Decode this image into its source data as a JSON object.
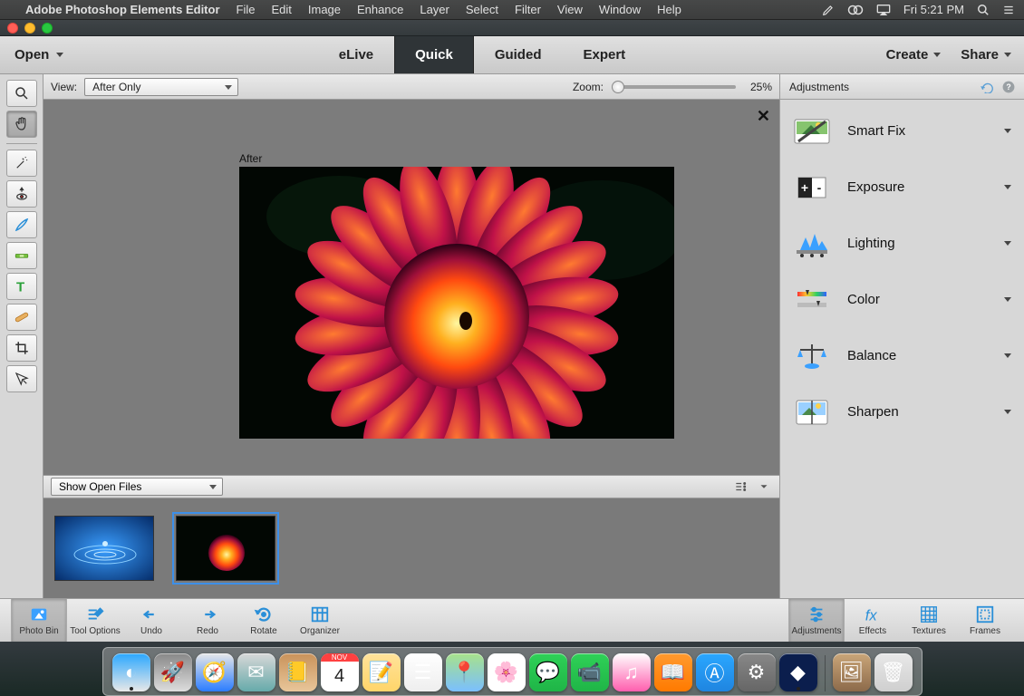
{
  "menubar": {
    "app_name": "Adobe Photoshop Elements Editor",
    "items": [
      "File",
      "Edit",
      "Image",
      "Enhance",
      "Layer",
      "Select",
      "Filter",
      "View",
      "Window",
      "Help"
    ],
    "clock": "Fri 5:21 PM"
  },
  "modebar": {
    "open_label": "Open",
    "tabs": [
      "eLive",
      "Quick",
      "Guided",
      "Expert"
    ],
    "active_tab": "Quick",
    "create_label": "Create",
    "share_label": "Share"
  },
  "viewbar": {
    "view_label": "View:",
    "view_value": "After Only",
    "zoom_label": "Zoom:",
    "zoom_value": "25%"
  },
  "canvas": {
    "after_label": "After"
  },
  "openfiles": {
    "dropdown": "Show Open Files"
  },
  "left_tools": [
    {
      "name": "zoom-tool",
      "icon": "zoom"
    },
    {
      "name": "hand-tool",
      "icon": "hand",
      "selected": true
    },
    {
      "name": "quick-select-tool",
      "icon": "wand"
    },
    {
      "name": "redeye-tool",
      "icon": "redeye"
    },
    {
      "name": "whiten-teeth-tool",
      "icon": "brush"
    },
    {
      "name": "straighten-tool",
      "icon": "level"
    },
    {
      "name": "type-tool",
      "icon": "type"
    },
    {
      "name": "spot-heal-tool",
      "icon": "bandaid"
    },
    {
      "name": "crop-tool",
      "icon": "crop"
    },
    {
      "name": "move-tool",
      "icon": "move"
    }
  ],
  "adjustments_panel": {
    "title": "Adjustments",
    "items": [
      {
        "label": "Smart Fix",
        "icon": "smartfix"
      },
      {
        "label": "Exposure",
        "icon": "exposure"
      },
      {
        "label": "Lighting",
        "icon": "lighting"
      },
      {
        "label": "Color",
        "icon": "color"
      },
      {
        "label": "Balance",
        "icon": "balance"
      },
      {
        "label": "Sharpen",
        "icon": "sharpen"
      }
    ]
  },
  "bottombar": {
    "left": [
      {
        "label": "Photo Bin",
        "icon": "photobin",
        "selected": true
      },
      {
        "label": "Tool Options",
        "icon": "toolopt"
      },
      {
        "label": "Undo",
        "icon": "undo"
      },
      {
        "label": "Redo",
        "icon": "redo"
      },
      {
        "label": "Rotate",
        "icon": "rotate"
      },
      {
        "label": "Organizer",
        "icon": "organizer"
      }
    ],
    "right": [
      {
        "label": "Adjustments",
        "icon": "adjust",
        "selected": true
      },
      {
        "label": "Effects",
        "icon": "fx"
      },
      {
        "label": "Textures",
        "icon": "textures"
      },
      {
        "label": "Frames",
        "icon": "frames"
      }
    ]
  },
  "dock": {
    "apps": [
      {
        "name": "finder",
        "color1": "#2aa7ff",
        "color2": "#e8e8e8",
        "glyph": "◐"
      },
      {
        "name": "launchpad",
        "color1": "#888",
        "color2": "#ddd",
        "glyph": "🚀"
      },
      {
        "name": "safari",
        "color1": "#e8e8e8",
        "color2": "#2a7cff",
        "glyph": "🧭"
      },
      {
        "name": "mail",
        "color1": "#d8d8d8",
        "color2": "#6aa",
        "glyph": "✉"
      },
      {
        "name": "contacts",
        "color1": "#c9925a",
        "color2": "#e8c69a",
        "glyph": "📒"
      },
      {
        "name": "calendar",
        "color1": "#fff",
        "color2": "#ff4040",
        "glyph": "4"
      },
      {
        "name": "notes",
        "color1": "#ffe29a",
        "color2": "#ffd56a",
        "glyph": "📝"
      },
      {
        "name": "reminders",
        "color1": "#fff",
        "color2": "#eee",
        "glyph": "☰"
      },
      {
        "name": "maps",
        "color1": "#a8e28a",
        "color2": "#7abfff",
        "glyph": "📍"
      },
      {
        "name": "photos",
        "color1": "#fff",
        "color2": "#fff",
        "glyph": "🌸"
      },
      {
        "name": "messages",
        "color1": "#2fd157",
        "color2": "#1fb547",
        "glyph": "💬"
      },
      {
        "name": "facetime",
        "color1": "#2fd157",
        "color2": "#1fb547",
        "glyph": "📹"
      },
      {
        "name": "itunes",
        "color1": "#fff",
        "color2": "#ff5eae",
        "glyph": "♫"
      },
      {
        "name": "ibooks",
        "color1": "#ff9a2f",
        "color2": "#ff7a00",
        "glyph": "📖"
      },
      {
        "name": "appstore",
        "color1": "#2aa7ff",
        "color2": "#1f85e0",
        "glyph": "Ⓐ"
      },
      {
        "name": "settings",
        "color1": "#888",
        "color2": "#666",
        "glyph": "⚙"
      },
      {
        "name": "pse",
        "color1": "#0b1e4d",
        "color2": "#0b1e4d",
        "glyph": "◆"
      }
    ],
    "right": [
      {
        "name": "desktop-img",
        "color1": "#caa679",
        "color2": "#8c6a4a",
        "glyph": "🖼"
      },
      {
        "name": "trash",
        "color1": "#e8e8e8",
        "color2": "#cfcfcf",
        "glyph": "🗑"
      }
    ],
    "running": [
      "finder",
      "pse"
    ]
  }
}
